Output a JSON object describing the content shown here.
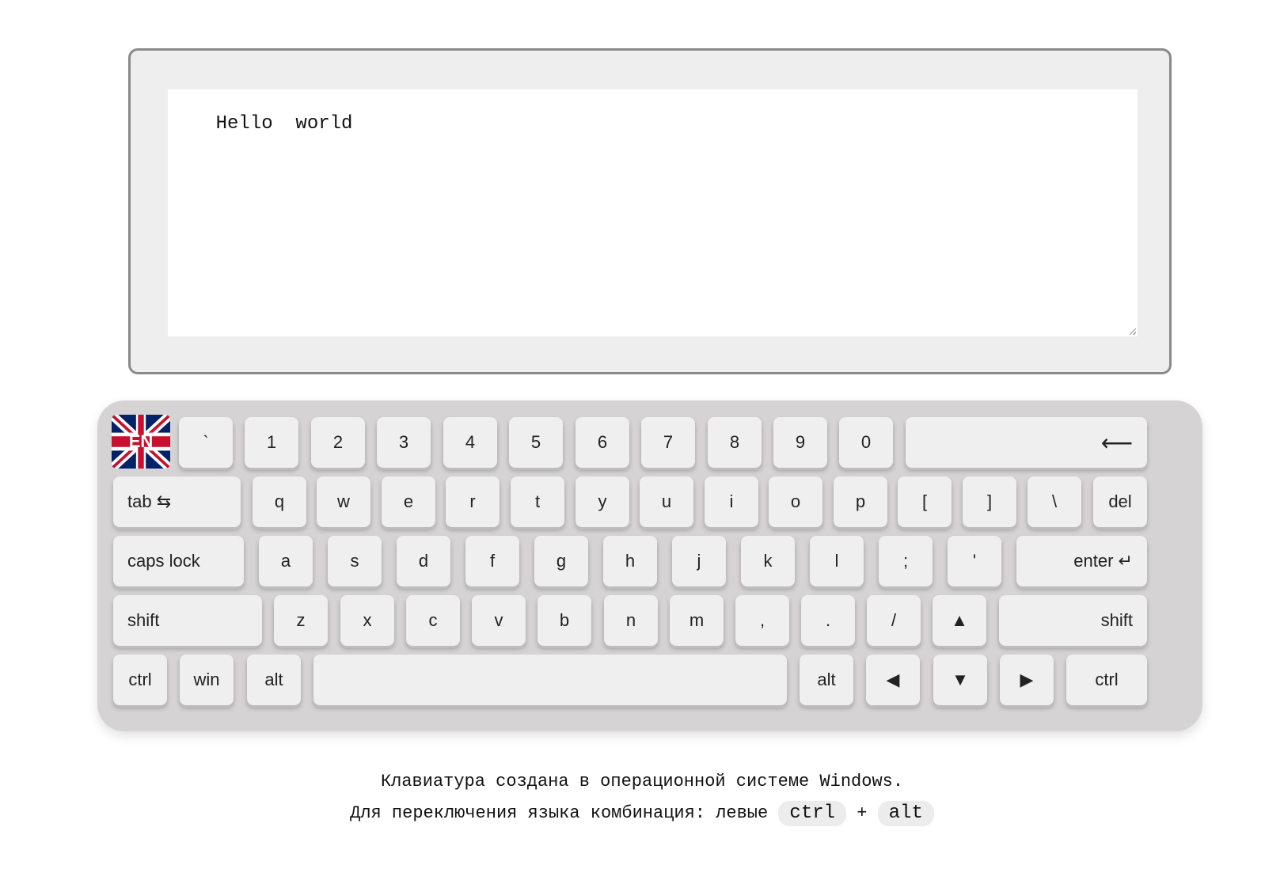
{
  "editor": {
    "text": "Hello  world"
  },
  "keyboard": {
    "lang_label": "EN",
    "row1": {
      "backtick": "`",
      "k1": "1",
      "k2": "2",
      "k3": "3",
      "k4": "4",
      "k5": "5",
      "k6": "6",
      "k7": "7",
      "k8": "8",
      "k9": "9",
      "k0": "0",
      "backspace": "⟵"
    },
    "row2": {
      "tab": "tab ⇆",
      "q": "q",
      "w": "w",
      "e": "e",
      "r": "r",
      "t": "t",
      "y": "y",
      "u": "u",
      "i": "i",
      "o": "o",
      "p": "p",
      "lbracket": "[",
      "rbracket": "]",
      "backslash": "\\",
      "del": "del"
    },
    "row3": {
      "caps": "caps lock",
      "a": "a",
      "s": "s",
      "d": "d",
      "f": "f",
      "g": "g",
      "h": "h",
      "j": "j",
      "k": "k",
      "l": "l",
      "semicolon": ";",
      "quote": "'",
      "enter": "enter ↵"
    },
    "row4": {
      "shift_left": "shift",
      "z": "z",
      "x": "x",
      "c": "c",
      "v": "v",
      "b": "b",
      "n": "n",
      "m": "m",
      "comma": ",",
      "period": ".",
      "slash": "/",
      "up": "▲",
      "shift_right": "shift"
    },
    "row5": {
      "ctrl_left": "ctrl",
      "win": "win",
      "alt_left": "alt",
      "space": "",
      "alt_right": "alt",
      "left": "◀",
      "down": "▼",
      "right": "▶",
      "ctrl_right": "ctrl"
    }
  },
  "footer": {
    "line1": "Клавиатура создана в операционной системе Windows.",
    "line2_text": "Для переключения языка комбинация: левые ",
    "key_ctrl": "ctrl",
    "plus": "+",
    "key_alt": "alt"
  },
  "colors": {
    "flag_blue": "#012169",
    "flag_red": "#C8102E"
  }
}
